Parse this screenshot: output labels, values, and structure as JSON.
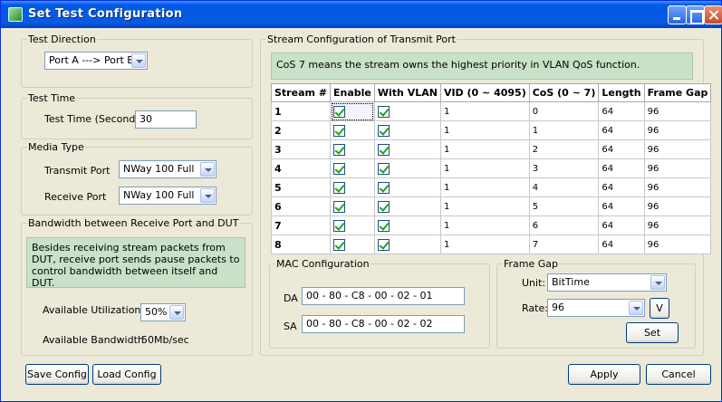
{
  "window": {
    "title": "Set Test Configuration"
  },
  "test_direction": {
    "legend": "Test Direction",
    "value": "Port A ---> Port B"
  },
  "test_time": {
    "legend": "Test Time",
    "label": "Test Time (Second)",
    "value": "30"
  },
  "media_type": {
    "legend": "Media Type",
    "transmit_label": "Transmit Port",
    "transmit_value": "NWay 100 Full",
    "receive_label": "Receive Port",
    "receive_value": "NWay 100 Full"
  },
  "bandwidth": {
    "legend": "Bandwidth between Receive Port and DUT",
    "note": "Besides receiving stream packets from DUT, receive port sends pause packets to control bandwidth between itself and DUT.",
    "util_label": "Available Utilization",
    "util_value": "50%",
    "bw_label": "Available Bandwidth",
    "bw_value": "50Mb/sec"
  },
  "stream_config": {
    "legend": "Stream Configuration of Transmit Port",
    "note": "CoS 7 means the stream owns the highest priority in VLAN QoS function.",
    "columns": [
      "Stream #",
      "Enable",
      "With VLAN",
      "VID  (0 ~ 4095)",
      "CoS (0 ~ 7)",
      "Length",
      "Frame Gap"
    ],
    "rows": [
      {
        "stream": "1",
        "vid": "1",
        "cos": "0",
        "length": "64",
        "gap": "96"
      },
      {
        "stream": "2",
        "vid": "1",
        "cos": "1",
        "length": "64",
        "gap": "96"
      },
      {
        "stream": "3",
        "vid": "1",
        "cos": "2",
        "length": "64",
        "gap": "96"
      },
      {
        "stream": "4",
        "vid": "1",
        "cos": "3",
        "length": "64",
        "gap": "96"
      },
      {
        "stream": "5",
        "vid": "1",
        "cos": "4",
        "length": "64",
        "gap": "96"
      },
      {
        "stream": "6",
        "vid": "1",
        "cos": "5",
        "length": "64",
        "gap": "96"
      },
      {
        "stream": "7",
        "vid": "1",
        "cos": "6",
        "length": "64",
        "gap": "96"
      },
      {
        "stream": "8",
        "vid": "1",
        "cos": "7",
        "length": "64",
        "gap": "96"
      }
    ]
  },
  "mac": {
    "legend": "MAC Configuration",
    "da_label": "DA",
    "da_value": "00 - 80 - C8 - 00 - 02 - 01",
    "sa_label": "SA",
    "sa_value": "00 - 80 - C8 - 00 - 02 - 02"
  },
  "frame_gap": {
    "legend": "Frame Gap",
    "unit_label": "Unit:",
    "unit_value": "BitTime",
    "rate_label": "Rate:",
    "rate_value": "96",
    "v_button": "V",
    "set_button": "Set"
  },
  "footer": {
    "save": "Save Config",
    "load": "Load Config",
    "apply": "Apply",
    "cancel": "Cancel"
  }
}
